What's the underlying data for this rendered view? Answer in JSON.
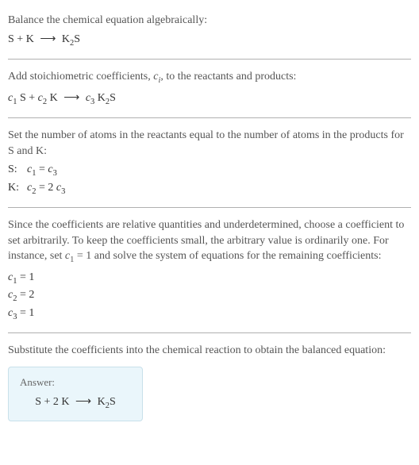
{
  "section1": {
    "title": "Balance the chemical equation algebraically:",
    "eq_lhs1": "S",
    "eq_plus": " + ",
    "eq_lhs2": "K",
    "arrow": "⟶",
    "eq_rhs_base": "K",
    "eq_rhs_sub": "2",
    "eq_rhs_tail": "S"
  },
  "section2": {
    "text_part1": "Add stoichiometric coefficients, ",
    "ci_c": "c",
    "ci_i": "i",
    "text_part2": ", to the reactants and products:",
    "c1": "c",
    "c1sub": "1",
    "sp1": " S + ",
    "c2": "c",
    "c2sub": "2",
    "sp2": " K ",
    "arrow": "⟶",
    "sp3": " ",
    "c3": "c",
    "c3sub": "3",
    "sp4": " K",
    "k2sub": "2",
    "tail": "S"
  },
  "section3": {
    "intro": "Set the number of atoms in the reactants equal to the number of atoms in the products for S and K:",
    "rows": [
      {
        "label": "S:",
        "lhs_c": "c",
        "lhs_sub": "1",
        "eq": " = ",
        "rhs_pre": "",
        "rhs_c": "c",
        "rhs_sub": "3"
      },
      {
        "label": "K:",
        "lhs_c": "c",
        "lhs_sub": "2",
        "eq": " = ",
        "rhs_pre": "2 ",
        "rhs_c": "c",
        "rhs_sub": "3"
      }
    ]
  },
  "section4": {
    "text_a": "Since the coefficients are relative quantities and underdetermined, choose a coefficient to set arbitrarily. To keep the coefficients small, the arbitrary value is ordinarily one. For instance, set ",
    "c1c": "c",
    "c1s": "1",
    "text_b": " = 1 and solve the system of equations for the remaining coefficients:",
    "lines": [
      {
        "c": "c",
        "sub": "1",
        "val": " = 1"
      },
      {
        "c": "c",
        "sub": "2",
        "val": " = 2"
      },
      {
        "c": "c",
        "sub": "3",
        "val": " = 1"
      }
    ]
  },
  "section5": {
    "text": "Substitute the coefficients into the chemical reaction to obtain the balanced equation:",
    "answer_label": "Answer:",
    "eq_lhs": "S + 2 K ",
    "arrow": "⟶",
    "eq_rhs_pre": " K",
    "eq_rhs_sub": "2",
    "eq_rhs_tail": "S"
  }
}
